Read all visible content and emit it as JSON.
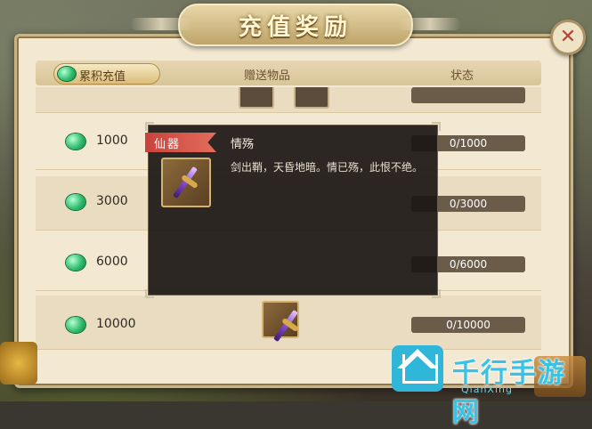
{
  "title": "充值奖励",
  "header": {
    "col1": "累积充值",
    "col2": "赠送物品",
    "col3": "状态"
  },
  "rows": [
    {
      "amount": "1000",
      "status": "0/1000"
    },
    {
      "amount": "3000",
      "status": "0/3000"
    },
    {
      "amount": "6000",
      "status": "0/6000"
    },
    {
      "amount": "10000",
      "status": "0/10000"
    }
  ],
  "tooltip": {
    "tag": "仙器",
    "name": "情殇",
    "description": "剑出鞘，天昏地暗。情已殇，此恨不绝。"
  },
  "watermark": {
    "cn": "千行手游网",
    "en": "QianXing"
  },
  "icons": {
    "gem": "jade-gem-icon",
    "close": "close-icon",
    "item": "sword-item-icon"
  },
  "colors": {
    "accent": "#2fb6d8",
    "gem": "#2fbd6d",
    "tag": "#c8423c"
  }
}
